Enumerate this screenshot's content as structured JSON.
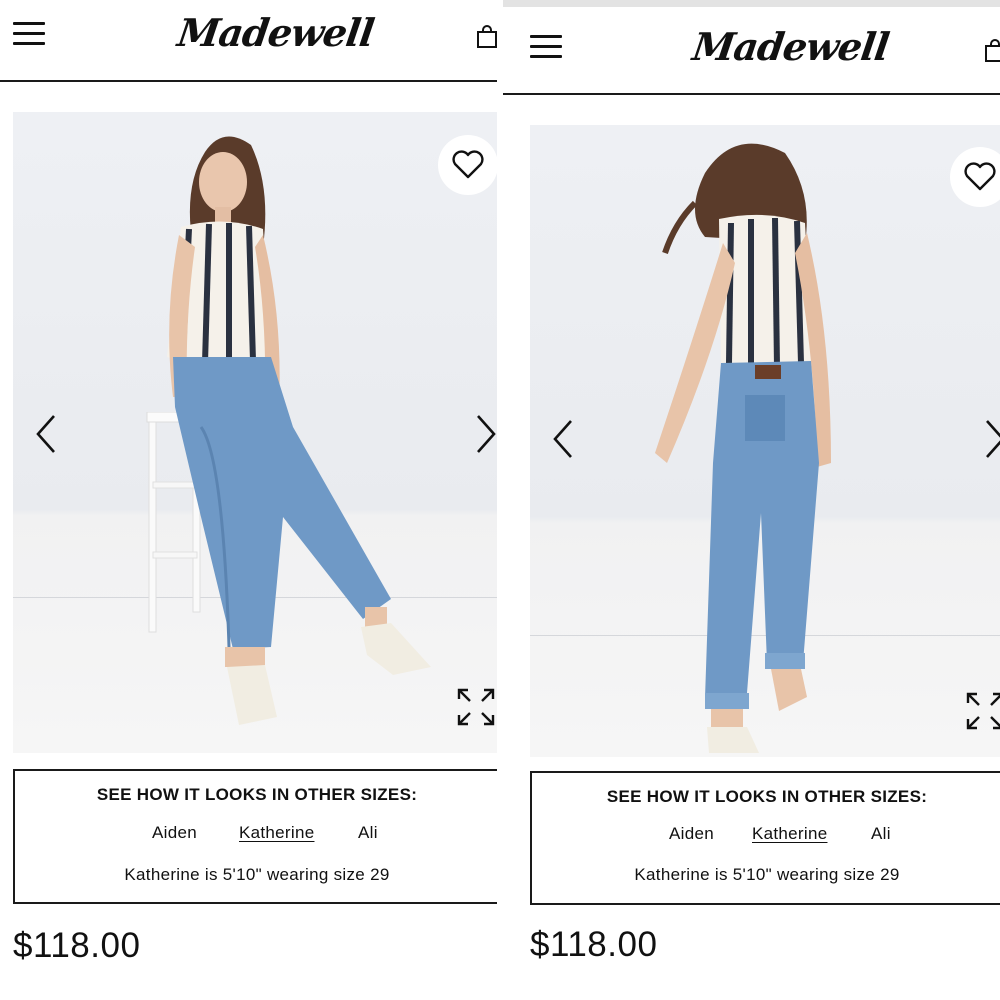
{
  "app": {
    "brand": "Madewell"
  },
  "product": {
    "price": "$118.00",
    "see_sizes_title": "SEE HOW IT LOOKS IN OTHER SIZES:",
    "models": [
      "Aiden",
      "Katherine",
      "Ali"
    ],
    "selected_model": "Katherine",
    "model_note": "Katherine is 5'10\" wearing size 29"
  },
  "gallery": {
    "images": [
      "front-view",
      "back-view"
    ]
  },
  "icons": {
    "menu": "hamburger-menu-icon",
    "bag": "shopping-bag-icon",
    "favorite": "heart-icon",
    "prev": "chevron-left-icon",
    "next": "chevron-right-icon",
    "expand": "expand-icon"
  },
  "colors": {
    "text": "#111111",
    "denim": "#6f99c6",
    "background": "#ffffff"
  }
}
